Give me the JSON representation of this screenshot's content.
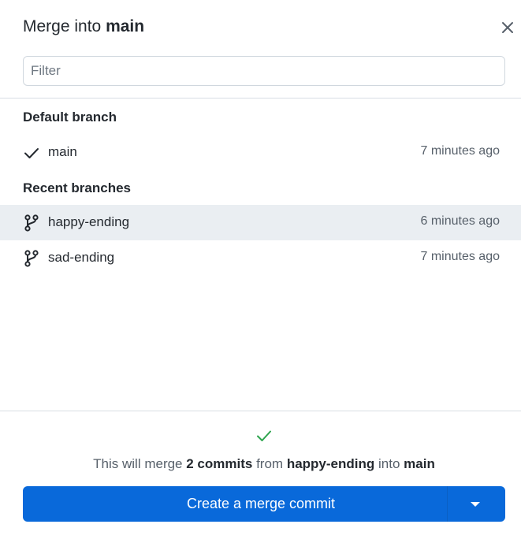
{
  "dialog": {
    "title_prefix": "Merge into",
    "title_branch": "main",
    "close_icon": "close-icon"
  },
  "filter": {
    "placeholder": "Filter",
    "value": ""
  },
  "sections": {
    "default_heading": "Default branch",
    "recent_heading": "Recent branches"
  },
  "default_branch": {
    "name": "main",
    "time": "7 minutes ago",
    "icon": "check-icon"
  },
  "recent_branches": [
    {
      "name": "happy-ending",
      "time": "6 minutes ago",
      "icon": "git-branch-icon",
      "selected": true
    },
    {
      "name": "sad-ending",
      "time": "7 minutes ago",
      "icon": "git-branch-icon",
      "selected": false
    }
  ],
  "merge_status": {
    "icon": "success-check-icon",
    "text_1": "This will merge",
    "commits": "2 commits",
    "text_2": "from",
    "source": "happy-ending",
    "text_3": "into",
    "target": "main"
  },
  "merge_button": {
    "label": "Create a merge commit",
    "dropdown_icon": "caret-down-icon"
  },
  "colors": {
    "accent": "#0969da",
    "success": "#2da44e",
    "highlight": "#eaeef2"
  }
}
